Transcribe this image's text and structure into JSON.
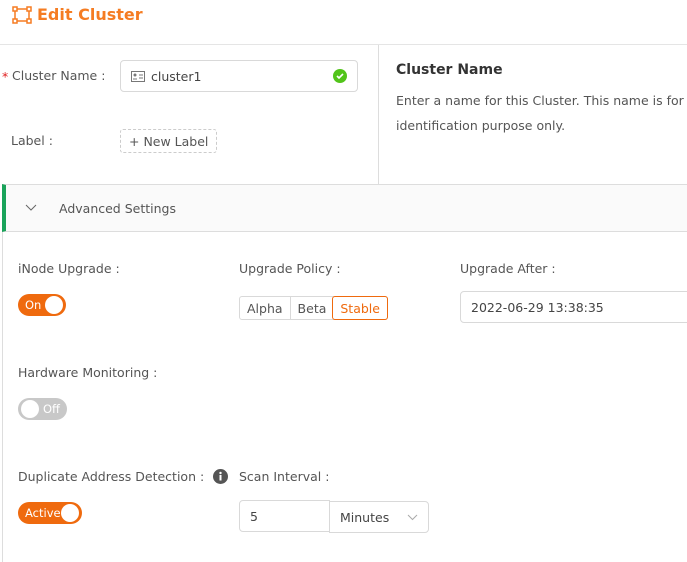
{
  "header": {
    "title": "Edit Cluster",
    "icon": "cluster-icon",
    "accent": "#f57c22"
  },
  "form": {
    "cluster_name": {
      "required_mark": "*",
      "label": "Cluster Name :",
      "value": "cluster1",
      "status": "valid"
    },
    "label": {
      "label": "Label :",
      "button": "+ New Label"
    }
  },
  "help": {
    "title": "Cluster Name",
    "text_line1": "Enter a name for this Cluster. This name is for",
    "text_line2": "identification purpose only."
  },
  "advanced": {
    "title": "Advanced Settings",
    "expanded": true,
    "inode_upgrade": {
      "label": "iNode Upgrade :",
      "toggle": "On",
      "enabled": true
    },
    "upgrade_policy": {
      "label": "Upgrade Policy :",
      "options": [
        "Alpha",
        "Beta",
        "Stable"
      ],
      "selected": "Stable"
    },
    "upgrade_after": {
      "label": "Upgrade After :",
      "value": "2022-06-29 13:38:35"
    },
    "hardware_monitoring": {
      "label": "Hardware Monitoring :",
      "toggle": "Off",
      "enabled": false
    },
    "duplicate_detection": {
      "label": "Duplicate Address Detection :",
      "toggle": "Active",
      "enabled": true
    },
    "scan_interval": {
      "label": "Scan Interval :",
      "value": "5",
      "unit": "Minutes"
    }
  }
}
